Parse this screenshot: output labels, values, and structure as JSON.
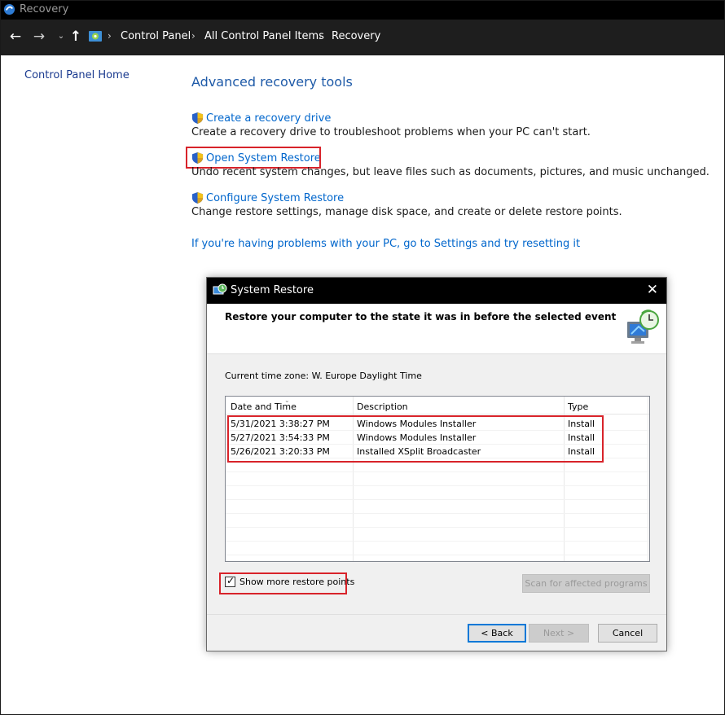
{
  "window": {
    "title": "Recovery"
  },
  "address_bar": {
    "breadcrumbs": [
      "Control Panel",
      "All Control Panel Items",
      "Recovery"
    ],
    "separator": "›"
  },
  "left_nav": {
    "home_link": "Control Panel Home"
  },
  "main": {
    "title": "Advanced recovery tools",
    "tasks": [
      {
        "link": "Create a recovery drive",
        "description": "Create a recovery drive to troubleshoot problems when your PC can't start."
      },
      {
        "link": "Open System Restore",
        "description": "Undo recent system changes, but leave files such as documents, pictures, and music unchanged."
      },
      {
        "link": "Configure System Restore",
        "description": "Change restore settings, manage disk space, and create or delete restore points."
      }
    ],
    "reset_link": "If you're having problems with your PC, go to Settings and try resetting it"
  },
  "dialog": {
    "title": "System Restore",
    "close_glyph": "✕",
    "heading": "Restore your computer to the state it was in before the selected event",
    "timezone": "Current time zone: W. Europe Daylight Time",
    "columns": [
      "Date and Time",
      "Description",
      "Type"
    ],
    "rows": [
      {
        "date": "5/31/2021 3:38:27 PM",
        "description": "Windows Modules Installer",
        "type": "Install"
      },
      {
        "date": "5/27/2021 3:54:33 PM",
        "description": "Windows Modules Installer",
        "type": "Install"
      },
      {
        "date": "5/26/2021 3:20:33 PM",
        "description": "Installed XSplit Broadcaster",
        "type": "Install"
      }
    ],
    "show_more": {
      "label": "Show more restore points",
      "checked": true
    },
    "scan_button": "Scan for affected programs",
    "back_button": "< Back",
    "next_button": "Next >",
    "cancel_button": "Cancel"
  },
  "colors": {
    "link": "#0066cc",
    "title": "#1e5aa8",
    "highlight": "#d8232a"
  }
}
